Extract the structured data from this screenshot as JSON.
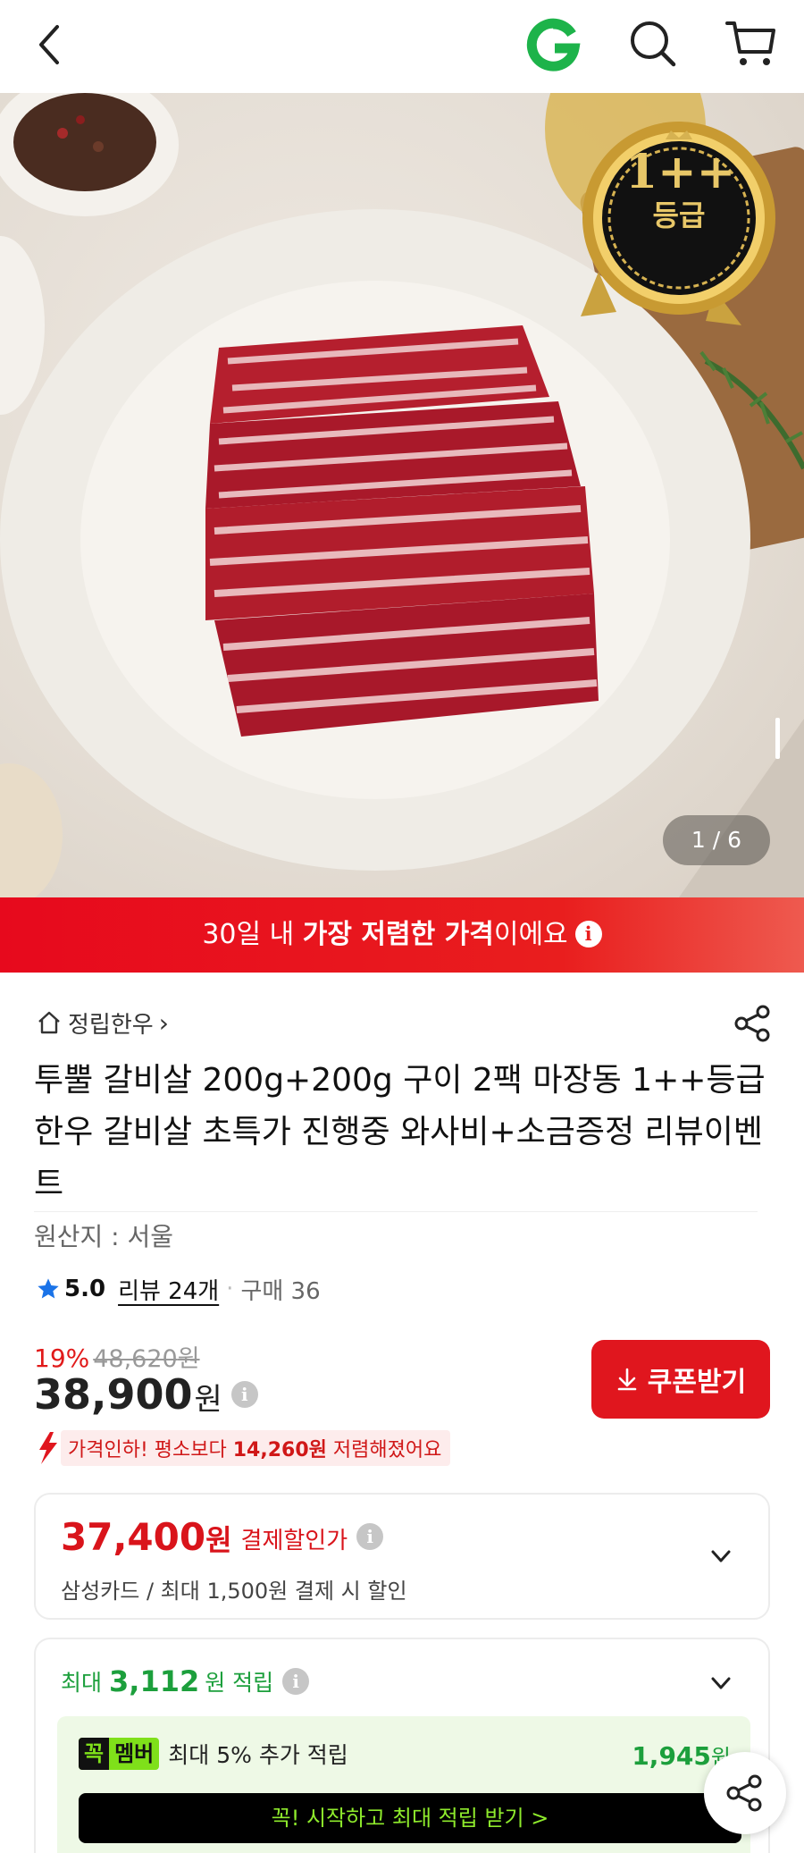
{
  "header": {
    "back_icon": "chevron-left-icon",
    "logo_icon": "gmarket-g-logo",
    "search_icon": "search-icon",
    "cart_icon": "cart-icon"
  },
  "gallery": {
    "counter": "1 / 6",
    "badge_top": "1++",
    "badge_bottom": "등급"
  },
  "banner": {
    "part1": "30일 내 ",
    "bold": "가장 저렴한 가격",
    "part2": "이에요",
    "info": "i"
  },
  "product": {
    "store": "정립한우",
    "store_chevron": "›",
    "title": "투뿔 갈비살 200g+200g 구이 2팩 마장동 1++등급 한우 갈비살 초특가 진행중 와사비+소금증정 리뷰이벤트",
    "origin": "원산지 : 서울",
    "rating": "5.0",
    "reviews": "리뷰 24개",
    "dot": "·",
    "purchases": "구매 36"
  },
  "price": {
    "discount_rate": "19%",
    "original": "48,620",
    "original_unit": "원",
    "sale": "38,900",
    "sale_unit": "원",
    "info": "i",
    "coupon_button": "쿠폰받기",
    "drop_prefix": "가격인하! 평소보다 ",
    "drop_amount": "14,260원",
    "drop_suffix": " 저렴해졌어요"
  },
  "payment": {
    "amount": "37,400",
    "unit": "원",
    "label": "결제할인가",
    "info": "i",
    "sub": "삼성카드 / 최대 1,500원 결제 시 할인"
  },
  "points": {
    "prefix": "최대",
    "amount": "3,112",
    "suffix": "원 적립",
    "info": "i",
    "member_badge_1": "꼭",
    "member_badge_2": "멤버",
    "member_text": "최대 5% 추가 적립",
    "member_amount": "1,945",
    "member_unit": "원",
    "cta": "꼭! 시작하고 최대 적립 받기 >"
  },
  "colors": {
    "accent_red": "#e0161e",
    "points_green": "#1c9f3c",
    "member_green": "#7fe01a"
  }
}
